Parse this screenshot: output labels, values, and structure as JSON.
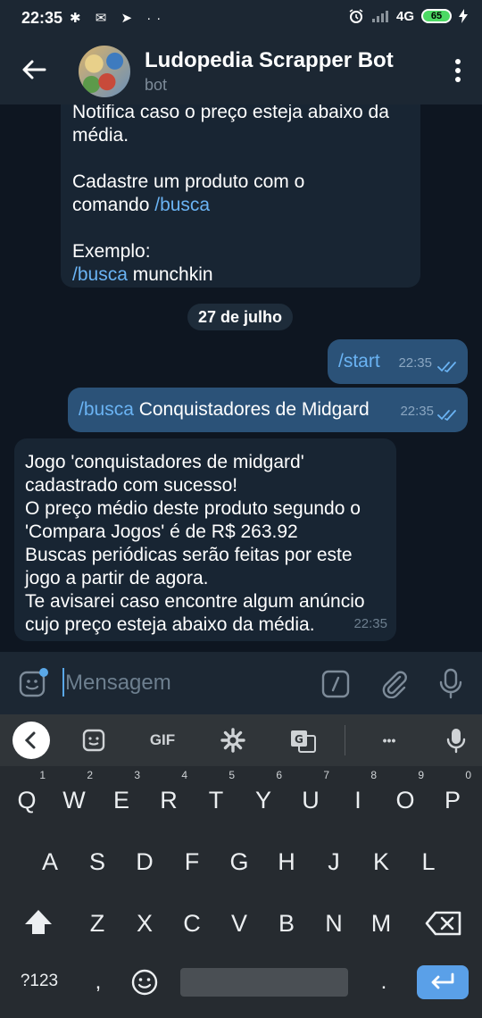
{
  "status_bar": {
    "time": "22:35",
    "left_icons": "✱ ✉ ➤ ··",
    "network": "4G",
    "battery": "65"
  },
  "header": {
    "title": "Ludopedia Scrapper Bot",
    "subtitle": "bot"
  },
  "messages": [
    {
      "id": 1,
      "direction": "in",
      "lines": [
        {
          "text": "Notifica caso o preço esteja abaixo da"
        },
        {
          "text": "média."
        },
        {
          "text": ""
        },
        {
          "text": "Cadastre um produto com o"
        },
        {
          "prefix": "comando ",
          "command": "/busca"
        },
        {
          "text": ""
        },
        {
          "text": "Exemplo:"
        },
        {
          "command": "/busca",
          "suffix": " munchkin"
        }
      ]
    },
    {
      "id": 2,
      "direction": "out",
      "command": "/start",
      "time": "22:35"
    },
    {
      "id": 3,
      "direction": "out",
      "command": "/busca",
      "text": " Conquistadores de Midgard",
      "time": "22:35"
    },
    {
      "id": 4,
      "direction": "in",
      "lines": [
        "Jogo 'conquistadores de midgard'",
        "cadastrado com sucesso!",
        "O preço médio deste produto segundo o",
        "'Compara Jogos' é de R$ 263.92",
        "Buscas periódicas serão feitas por este",
        "jogo a partir de agora.",
        "Te avisarei caso encontre algum anúncio",
        "cujo preço esteja abaixo da média."
      ],
      "time": "22:35"
    }
  ],
  "date_separator": "27 de julho",
  "input": {
    "placeholder": "Mensagem"
  },
  "keyboard": {
    "toolbar": {
      "gif_label": "GIF",
      "more_label": "•••"
    },
    "row1": [
      {
        "key": "Q",
        "num": "1"
      },
      {
        "key": "W",
        "num": "2"
      },
      {
        "key": "E",
        "num": "3"
      },
      {
        "key": "R",
        "num": "4"
      },
      {
        "key": "T",
        "num": "5"
      },
      {
        "key": "Y",
        "num": "6"
      },
      {
        "key": "U",
        "num": "7"
      },
      {
        "key": "I",
        "num": "8"
      },
      {
        "key": "O",
        "num": "9"
      },
      {
        "key": "P",
        "num": "0"
      }
    ],
    "row2": [
      "A",
      "S",
      "D",
      "F",
      "G",
      "H",
      "J",
      "K",
      "L"
    ],
    "row3": [
      "Z",
      "X",
      "C",
      "V",
      "B",
      "N",
      "M"
    ],
    "symbols_label": "?123",
    "comma_label": ",",
    "period_label": "."
  },
  "colors": {
    "background": "#0e1621",
    "header": "#1c2733",
    "incoming_bubble": "#182533",
    "outgoing_bubble": "#2b5278",
    "command_link": "#6ab3f3",
    "enter_key": "#5aa0e8"
  }
}
